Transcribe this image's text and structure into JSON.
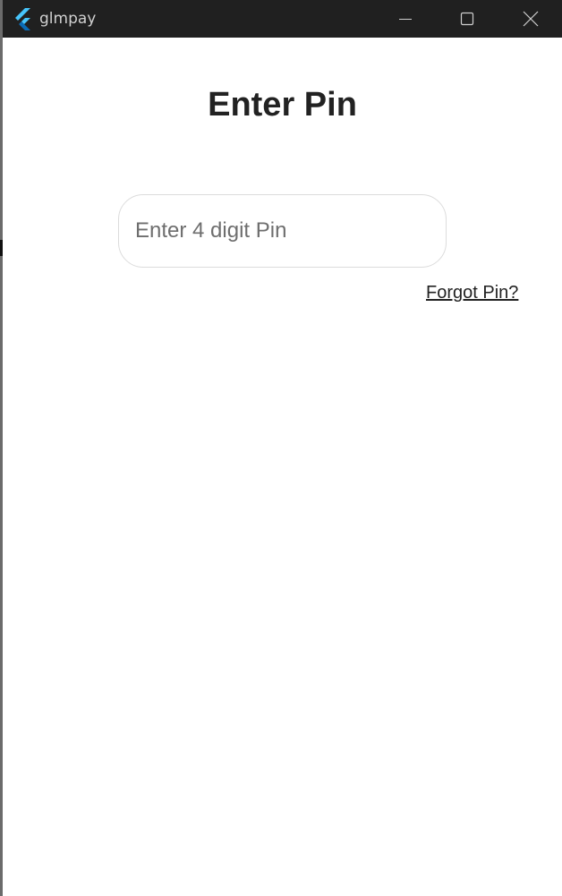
{
  "window": {
    "title": "glmpay",
    "controls": [
      "minimize-icon",
      "maximize-icon",
      "close-icon"
    ]
  },
  "colors": {
    "titlebar": "#202020",
    "logo_light": "#47c5fb",
    "logo_dark": "#0a6bb5",
    "input_border": "#dcdcdc"
  },
  "main": {
    "title": "Enter Pin",
    "pin_input": {
      "placeholder": "Enter 4 digit Pin",
      "value": ""
    },
    "forgot_link": "Forgot Pin?"
  }
}
